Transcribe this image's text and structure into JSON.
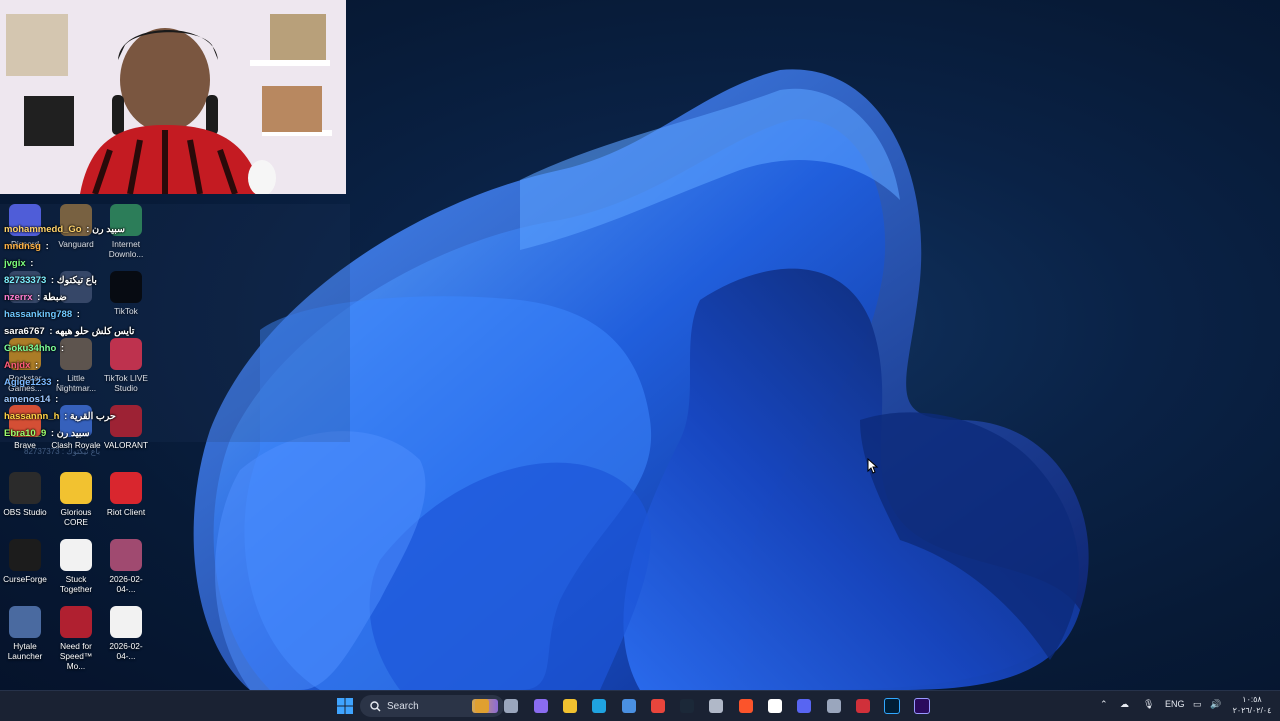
{
  "chat": [
    {
      "user": "mohammedd_Go",
      "text": "سبيد رن",
      "color": "#ffd36b"
    },
    {
      "user": "mndnsg",
      "text": "",
      "color": "#ffb347"
    },
    {
      "user": "jvgix",
      "text": "",
      "color": "#7dff7d"
    },
    {
      "user": "82733373",
      "text": "باع تيكتوك",
      "color": "#7ef0ff"
    },
    {
      "user": "nzerrx",
      "text": "ضبطة",
      "color": "#ff7dd0"
    },
    {
      "user": "hassanking788",
      "text": "",
      "color": "#6ec8ff"
    },
    {
      "user": "sara6767",
      "text": "تايس كلش حلو هيهه",
      "color": "#ffffff"
    },
    {
      "user": "Goku34hho",
      "text": "",
      "color": "#7dff9a"
    },
    {
      "user": "Anjdx",
      "text": "",
      "color": "#ff5a7a"
    },
    {
      "user": "Agige1233",
      "text": "",
      "color": "#7ab8ff"
    },
    {
      "user": "amenos14",
      "text": "",
      "color": "#9ec8ff"
    },
    {
      "user": "hassannn_h",
      "text": "حرب القرية",
      "color": "#ffd447"
    },
    {
      "user": "Ebra10_9",
      "text": "سبيد رن",
      "color": "#9dff6e"
    }
  ],
  "desktop_icons": [
    {
      "label": "Discord",
      "icon": "discord-icon",
      "color": "#5865f2"
    },
    {
      "label": "Vanguard",
      "icon": "vanguard-icon",
      "color": "#8a6a3a"
    },
    {
      "label": "Internet Downlo...",
      "icon": "idm-icon",
      "color": "#2e8b57"
    },
    {
      "label": "",
      "icon": "app-icon",
      "color": "#3a4a6a"
    },
    {
      "label": "",
      "icon": "app-icon",
      "color": "#3a4a6a"
    },
    {
      "label": "TikTok",
      "icon": "tiktok-icon",
      "color": "#000000"
    },
    {
      "label": "Rockstar Games...",
      "icon": "rockstar-icon",
      "color": "#c98a1a"
    },
    {
      "label": "Little Nightmar...",
      "icon": "game-icon",
      "color": "#6a5a4a"
    },
    {
      "label": "TikTok LIVE Studio",
      "icon": "tiktok-live-icon",
      "color": "#e0304a"
    },
    {
      "label": "Brave",
      "icon": "brave-icon",
      "color": "#fb542b"
    },
    {
      "label": "Clash Royale",
      "icon": "clash-royale-icon",
      "color": "#3a6ad0"
    },
    {
      "label": "VALORANT",
      "icon": "valorant-icon",
      "color": "#b81d2a"
    },
    {
      "label": "OBS Studio",
      "icon": "obs-icon",
      "color": "#2b2b2b"
    },
    {
      "label": "Glorious CORE",
      "icon": "glorious-icon",
      "color": "#f2c230"
    },
    {
      "label": "Riot Client",
      "icon": "riot-icon",
      "color": "#d9262e"
    },
    {
      "label": "CurseForge",
      "icon": "curseforge-icon",
      "color": "#1c1c1c"
    },
    {
      "label": "Stuck Together",
      "icon": "file-icon",
      "color": "#f2f2f2"
    },
    {
      "label": "2026-02-04-...",
      "icon": "image-file-icon",
      "color": "#a04a70"
    },
    {
      "label": "Hytale Launcher",
      "icon": "hytale-icon",
      "color": "#4a6aa0"
    },
    {
      "label": "Need for Speed™ Mo...",
      "icon": "nfs-icon",
      "color": "#b02030"
    },
    {
      "label": "2026-02-04-...",
      "icon": "file-icon",
      "color": "#f2f2f2"
    }
  ],
  "chat_overlay_footer": "82737373 : باع تيكتوك",
  "taskbar": {
    "search_label": "Search",
    "language": "ENG",
    "time": "١٠:٥٨",
    "date": "٢٠٢٦/٠٢/٠٤",
    "pins": [
      "start-icon",
      "search-icon",
      "widgets-icon",
      "task-view-icon",
      "copilot-icon",
      "file-explorer-icon",
      "edge-icon",
      "store-icon",
      "chrome-icon",
      "steam-icon",
      "settings-icon",
      "brave-icon",
      "capcut-icon",
      "discord-icon",
      "chatgpt-icon",
      "app-icon",
      "photoshop-icon",
      "premiere-icon"
    ]
  }
}
